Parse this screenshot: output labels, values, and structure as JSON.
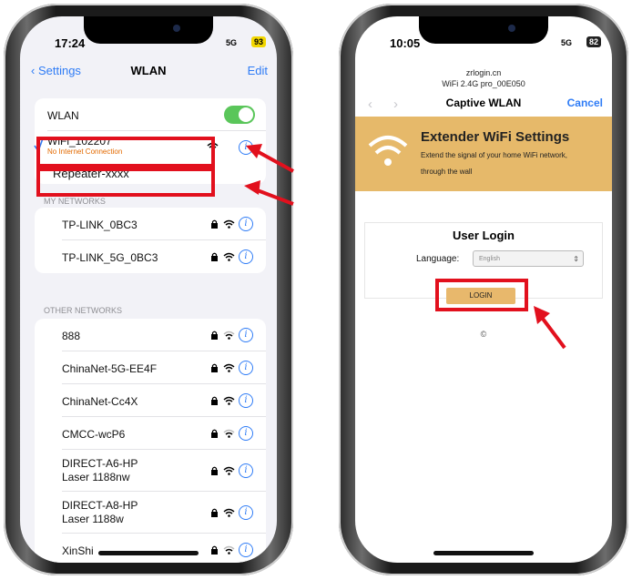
{
  "colors": {
    "accent": "#2f7cf6",
    "red": "#e2101d",
    "toggle_on": "#5ac65a",
    "banner": "#e6b96a",
    "warning": "#e36a00"
  },
  "left": {
    "status": {
      "time": "17:24",
      "network": "5G",
      "battery": "93"
    },
    "nav": {
      "back": "Settings",
      "title": "WLAN",
      "edit": "Edit"
    },
    "wlan_toggle_label": "WLAN",
    "current": {
      "ssid": "WiFi_102207",
      "status": "No Internet Connection"
    },
    "repeater": "Repeater-xxxx",
    "my_networks_header": "MY NETWORKS",
    "my_networks": [
      "TP-LINK_0BC3",
      "TP-LINK_5G_0BC3"
    ],
    "other_networks_header": "OTHER NETWORKS",
    "other_networks": [
      {
        "line1": "888",
        "line2": ""
      },
      {
        "line1": "ChinaNet-5G-EE4F",
        "line2": ""
      },
      {
        "line1": "ChinaNet-Cc4X",
        "line2": ""
      },
      {
        "line1": "CMCC-wcP6",
        "line2": ""
      },
      {
        "line1": "DIRECT-A6-HP",
        "line2": "Laser 1188nw"
      },
      {
        "line1": "DIRECT-A8-HP",
        "line2": "Laser 1188w"
      },
      {
        "line1": "XinShi",
        "line2": ""
      }
    ]
  },
  "right": {
    "status": {
      "time": "10:05",
      "network": "5G",
      "battery": "82"
    },
    "url": "zrlogin.cn",
    "url_sub": "WiFi 2.4G pro_00E050",
    "nav": {
      "title": "Captive WLAN",
      "cancel": "Cancel"
    },
    "banner": {
      "title": "Extender WiFi Settings",
      "line1": "Extend the signal of your home WiFi network,",
      "line2": "through the wall"
    },
    "login": {
      "title": "User Login",
      "language_label": "Language:",
      "language_value": "English",
      "button": "LOGIN",
      "copyright": "©"
    }
  }
}
